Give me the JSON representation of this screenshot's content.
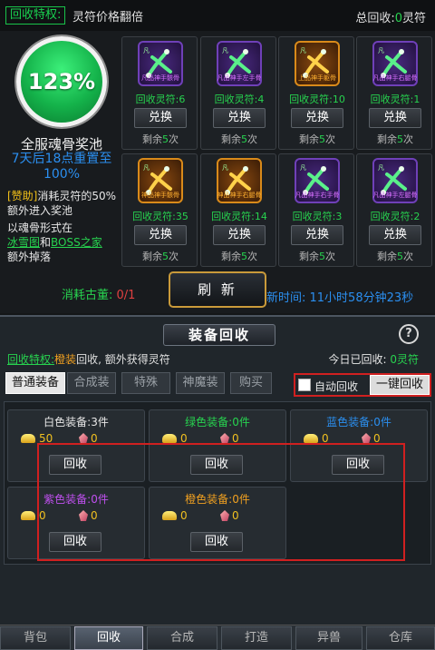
{
  "header": {
    "privilege_tag": "回收特权:",
    "privilege_desc": "灵符价格翻倍",
    "total_label": "总回收:",
    "total_value": "0",
    "total_unit": "灵符"
  },
  "pool": {
    "percent": "123%",
    "title": "全服魂骨奖池",
    "reset_text": "7天后18点重置至100%",
    "sponsor_tag": "[赞助]",
    "sponsor_text": "消耗灵符的50%额外进入奖池",
    "bone_text_1": "以魂骨形式在",
    "bone_link_1": "冰雪图",
    "bone_and": "和",
    "bone_link_2": "BOSS之家",
    "bone_text_2": "额外掉落"
  },
  "cards": [
    {
      "label": "凡品神手骸骨",
      "count_text": "回收灵符:6",
      "button": "兑换",
      "remain_pre": "剩余",
      "remain_num": "5",
      "remain_post": "次",
      "color": "#7a3cd0"
    },
    {
      "label": "凡品神手左手骨",
      "count_text": "回收灵符:4",
      "button": "兑换",
      "remain_pre": "剩余",
      "remain_num": "5",
      "remain_post": "次",
      "color": "#7a3cd0"
    },
    {
      "label": "上品神手躯骨",
      "count_text": "回收灵符:10",
      "button": "兑换",
      "remain_pre": "剩余",
      "remain_num": "5",
      "remain_post": "次",
      "color": "#d98a1a"
    },
    {
      "label": "凡品神手右腿骨",
      "count_text": "回收灵符:1",
      "button": "兑换",
      "remain_pre": "剩余",
      "remain_num": "5",
      "remain_post": "次",
      "color": "#7a3cd0"
    },
    {
      "label": "神品神手骸骨",
      "count_text": "回收灵符:35",
      "button": "兑换",
      "remain_pre": "剩余",
      "remain_num": "5",
      "remain_post": "次",
      "color": "#d98a1a"
    },
    {
      "label": "神品神手右腿骨",
      "count_text": "回收灵符:14",
      "button": "兑换",
      "remain_pre": "剩余",
      "remain_num": "5",
      "remain_post": "次",
      "color": "#d98a1a"
    },
    {
      "label": "凡品神手右手骨",
      "count_text": "回收灵符:3",
      "button": "兑换",
      "remain_pre": "剩余",
      "remain_num": "5",
      "remain_post": "次",
      "color": "#7a3cd0"
    },
    {
      "label": "凡品神手左腿骨",
      "count_text": "回收灵符:2",
      "button": "兑换",
      "remain_pre": "剩余",
      "remain_num": "5",
      "remain_post": "次",
      "color": "#7a3cd0"
    }
  ],
  "refresh": {
    "consume_label": "消耗古董:",
    "consume_value": "0/1",
    "button": "刷 新",
    "time_text": "新时间: 11小时58分钟23秒"
  },
  "recycle": {
    "title": "装备回收",
    "help": "?",
    "priv_tag": "回收特权:",
    "priv_item": "橙装",
    "priv_desc": "回收, 额外获得灵符",
    "today_label": "今日已回收:",
    "today_value": "0",
    "today_unit": "灵符",
    "tabs": [
      "普通装备",
      "合成装",
      "特殊",
      "神魔装",
      "购买"
    ],
    "auto_label": "自动回收",
    "onekey": "一键回收"
  },
  "equip": [
    {
      "title": "白色装备:3件",
      "title_color": "#e8e8e8",
      "gold": "50",
      "gem": "0",
      "button": "回收"
    },
    {
      "title": "绿色装备:0件",
      "title_color": "#27d34f",
      "gold": "0",
      "gem": "0",
      "button": "回收"
    },
    {
      "title": "蓝色装备:0件",
      "title_color": "#2b8ff0",
      "gold": "0",
      "gem": "0",
      "button": "回收"
    },
    {
      "title": "紫色装备:0件",
      "title_color": "#c050f0",
      "gold": "0",
      "gem": "0",
      "button": "回收"
    },
    {
      "title": "橙色装备:0件",
      "title_color": "#f0a020",
      "gold": "0",
      "gem": "0",
      "button": "回收"
    }
  ],
  "nav": [
    "背包",
    "回收",
    "合成",
    "打造",
    "异兽",
    "仓库"
  ]
}
